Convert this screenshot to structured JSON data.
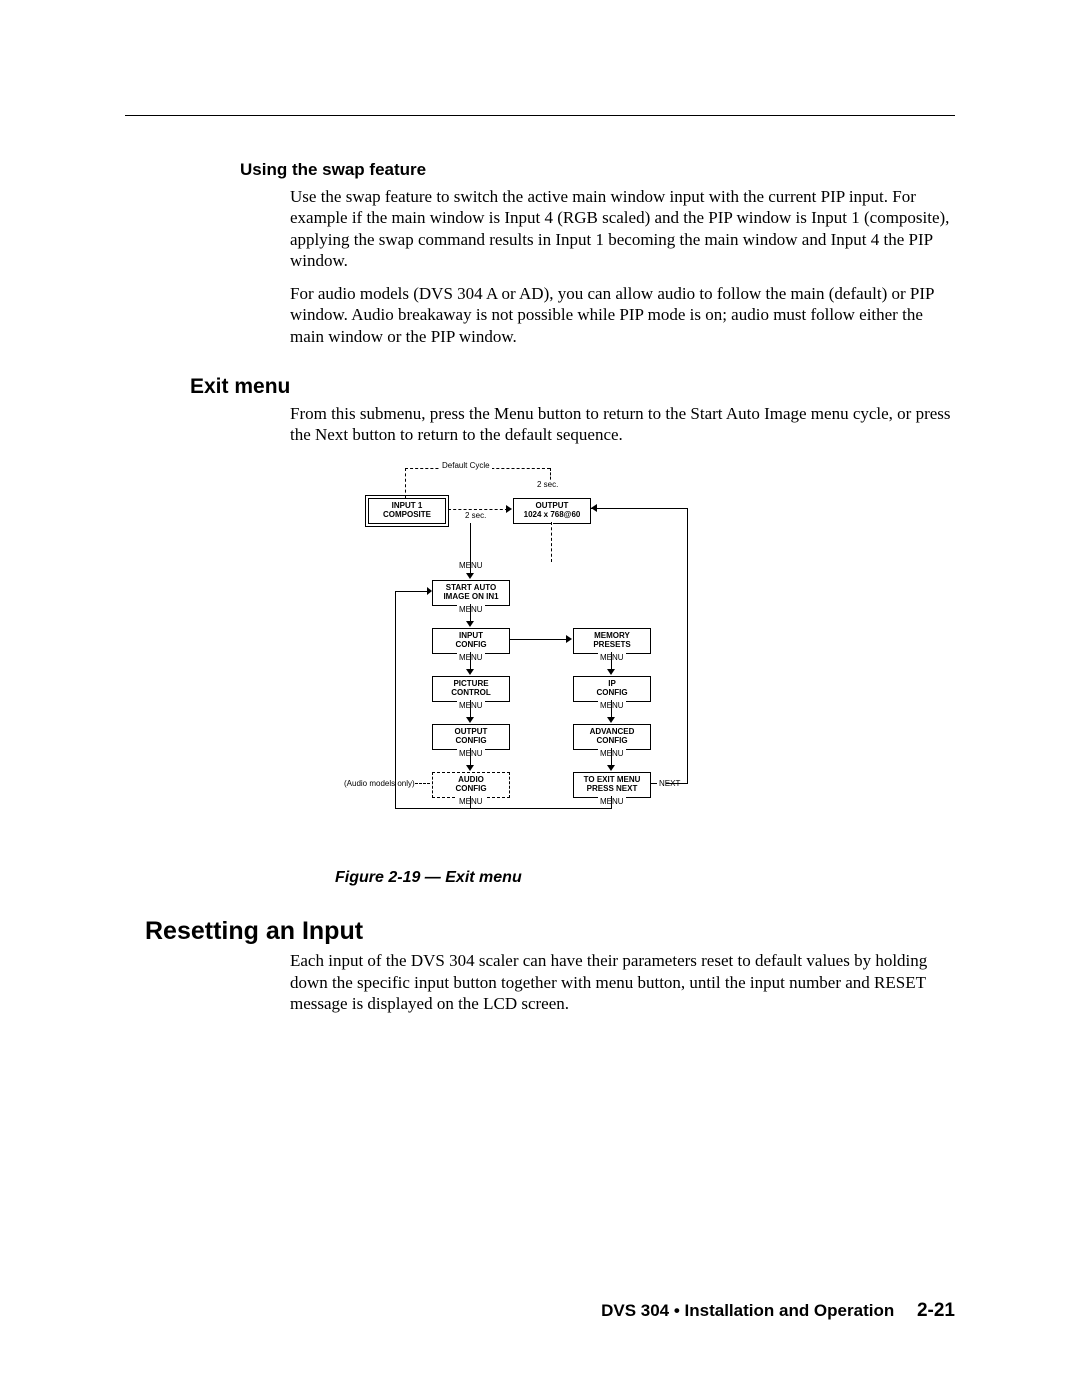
{
  "swap": {
    "heading": "Using the swap feature",
    "p1": "Use the swap feature to switch the active main window input with the current PIP input.  For example if the main window is Input 4 (RGB scaled) and the PIP window is Input 1 (composite), applying the swap command results in Input 1 becoming the main window and Input 4 the PIP window.",
    "p2": "For audio models (DVS 304 A or AD), you can allow audio to follow the main (default) or PIP window.  Audio breakaway is not possible while PIP mode is on; audio must follow either the main window or the PIP window."
  },
  "exit": {
    "heading": "Exit menu",
    "p1": "From this submenu, press the Menu button to return to the Start Auto Image menu cycle, or press the Next button to return to the default sequence."
  },
  "figure_caption": "Figure 2-19 — Exit menu",
  "reset": {
    "heading": "Resetting an Input",
    "p1": "Each input of the DVS 304 scaler can have their parameters reset to default values by holding down the specific input button together with menu button, until the input number and RESET message is displayed on the LCD screen."
  },
  "footer": {
    "title": "DVS 304 • Installation and Operation",
    "page": "2-21"
  },
  "chart_data": {
    "type": "diagram",
    "title": "Exit menu flowchart",
    "feedback_loop_label": "Default Cycle",
    "default_cycle": {
      "nodes": [
        {
          "id": "input1",
          "lines": [
            "INPUT 1",
            "COMPOSITE"
          ],
          "style": "double"
        },
        {
          "id": "output",
          "lines": [
            "OUTPUT",
            "1024 x 768@60"
          ],
          "style": "solid"
        }
      ],
      "edge_label": "2 sec.",
      "return_label": "2 sec."
    },
    "menu_chain_left": [
      {
        "id": "start_auto",
        "lines": [
          "START AUTO",
          "IMAGE ON IN1"
        ]
      },
      {
        "id": "input_config",
        "lines": [
          "INPUT",
          "CONFIG"
        ]
      },
      {
        "id": "picture_control",
        "lines": [
          "PICTURE",
          "CONTROL"
        ]
      },
      {
        "id": "output_config",
        "lines": [
          "OUTPUT",
          "CONFIG"
        ]
      },
      {
        "id": "audio_config",
        "lines": [
          "AUDIO",
          "CONFIG"
        ],
        "style": "dashed",
        "note_left": "(Audio models only)"
      }
    ],
    "menu_chain_right": [
      {
        "id": "memory_presets",
        "lines": [
          "MEMORY",
          "PRESETS"
        ]
      },
      {
        "id": "ip_config",
        "lines": [
          "IP",
          "CONFIG"
        ]
      },
      {
        "id": "advanced_config",
        "lines": [
          "ADVANCED",
          "CONFIG"
        ]
      },
      {
        "id": "exit_menu",
        "lines": [
          "TO EXIT MENU",
          "PRESS NEXT"
        ]
      }
    ],
    "edge_labels": {
      "vertical": "MENU",
      "exit_next": "NEXT"
    },
    "right_chain_entry_from": "input_config",
    "exit_next_target": "default_cycle",
    "right_chain_menu_loops_back_to": "start_auto"
  }
}
